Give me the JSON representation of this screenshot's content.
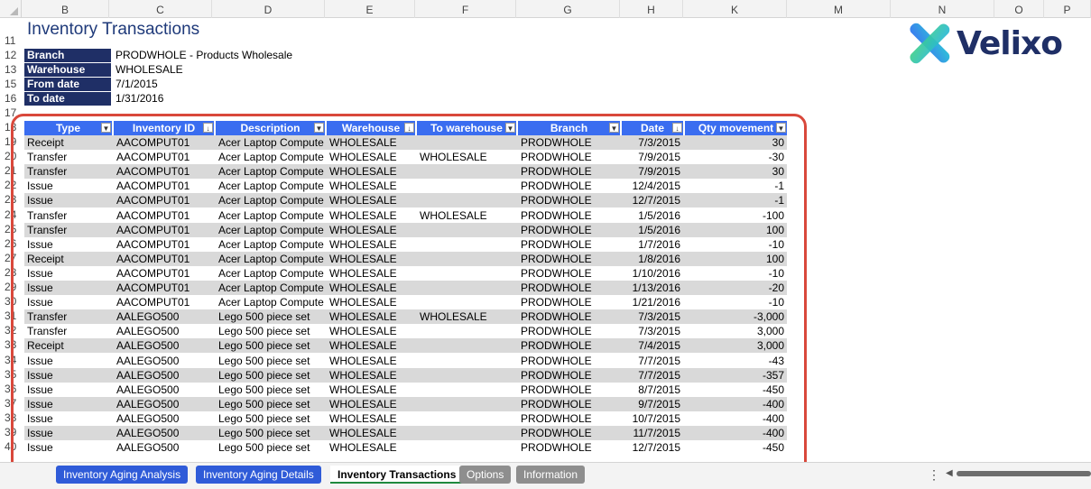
{
  "columns": [
    "B",
    "C",
    "D",
    "E",
    "F",
    "G",
    "H",
    "K",
    "M",
    "N",
    "O",
    "P"
  ],
  "row_numbers": [
    "11",
    "12",
    "13",
    "15",
    "16",
    "17",
    "18",
    "19",
    "20",
    "21",
    "22",
    "23",
    "24",
    "25",
    "26",
    "27",
    "28",
    "29",
    "30",
    "31",
    "32",
    "33",
    "34",
    "35",
    "36",
    "37",
    "38",
    "39",
    "40"
  ],
  "title": "Inventory Transactions",
  "params": [
    {
      "label": "Branch",
      "value": "PRODWHOLE - Products Wholesale"
    },
    {
      "label": "Warehouse",
      "value": "WHOLESALE"
    },
    {
      "label": "From date",
      "value": "7/1/2015"
    },
    {
      "label": "To date",
      "value": "1/31/2016"
    }
  ],
  "logo": {
    "text": "Velixo",
    "icon": "velixo-x-logo-icon"
  },
  "table": {
    "headers": [
      "Type",
      "Inventory ID",
      "Description",
      "Warehouse",
      "To warehouse",
      "Branch",
      "Date",
      "Qty movement"
    ],
    "rows": [
      [
        "Receipt",
        "AACOMPUT01",
        "Acer Laptop Compute",
        "WHOLESALE",
        "",
        "PRODWHOLE",
        "7/3/2015",
        "30"
      ],
      [
        "Transfer",
        "AACOMPUT01",
        "Acer Laptop Compute",
        "WHOLESALE",
        "WHOLESALE",
        "PRODWHOLE",
        "7/9/2015",
        "-30"
      ],
      [
        "Transfer",
        "AACOMPUT01",
        "Acer Laptop Compute",
        "WHOLESALE",
        "",
        "PRODWHOLE",
        "7/9/2015",
        "30"
      ],
      [
        "Issue",
        "AACOMPUT01",
        "Acer Laptop Compute",
        "WHOLESALE",
        "",
        "PRODWHOLE",
        "12/4/2015",
        "-1"
      ],
      [
        "Issue",
        "AACOMPUT01",
        "Acer Laptop Compute",
        "WHOLESALE",
        "",
        "PRODWHOLE",
        "12/7/2015",
        "-1"
      ],
      [
        "Transfer",
        "AACOMPUT01",
        "Acer Laptop Compute",
        "WHOLESALE",
        "WHOLESALE",
        "PRODWHOLE",
        "1/5/2016",
        "-100"
      ],
      [
        "Transfer",
        "AACOMPUT01",
        "Acer Laptop Compute",
        "WHOLESALE",
        "",
        "PRODWHOLE",
        "1/5/2016",
        "100"
      ],
      [
        "Issue",
        "AACOMPUT01",
        "Acer Laptop Compute",
        "WHOLESALE",
        "",
        "PRODWHOLE",
        "1/7/2016",
        "-10"
      ],
      [
        "Receipt",
        "AACOMPUT01",
        "Acer Laptop Compute",
        "WHOLESALE",
        "",
        "PRODWHOLE",
        "1/8/2016",
        "100"
      ],
      [
        "Issue",
        "AACOMPUT01",
        "Acer Laptop Compute",
        "WHOLESALE",
        "",
        "PRODWHOLE",
        "1/10/2016",
        "-10"
      ],
      [
        "Issue",
        "AACOMPUT01",
        "Acer Laptop Compute",
        "WHOLESALE",
        "",
        "PRODWHOLE",
        "1/13/2016",
        "-20"
      ],
      [
        "Issue",
        "AACOMPUT01",
        "Acer Laptop Compute",
        "WHOLESALE",
        "",
        "PRODWHOLE",
        "1/21/2016",
        "-10"
      ],
      [
        "Transfer",
        "AALEGO500",
        "Lego 500 piece set",
        "WHOLESALE",
        "WHOLESALE",
        "PRODWHOLE",
        "7/3/2015",
        "-3,000"
      ],
      [
        "Transfer",
        "AALEGO500",
        "Lego 500 piece set",
        "WHOLESALE",
        "",
        "PRODWHOLE",
        "7/3/2015",
        "3,000"
      ],
      [
        "Receipt",
        "AALEGO500",
        "Lego 500 piece set",
        "WHOLESALE",
        "",
        "PRODWHOLE",
        "7/4/2015",
        "3,000"
      ],
      [
        "Issue",
        "AALEGO500",
        "Lego 500 piece set",
        "WHOLESALE",
        "",
        "PRODWHOLE",
        "7/7/2015",
        "-43"
      ],
      [
        "Issue",
        "AALEGO500",
        "Lego 500 piece set",
        "WHOLESALE",
        "",
        "PRODWHOLE",
        "7/7/2015",
        "-357"
      ],
      [
        "Issue",
        "AALEGO500",
        "Lego 500 piece set",
        "WHOLESALE",
        "",
        "PRODWHOLE",
        "8/7/2015",
        "-450"
      ],
      [
        "Issue",
        "AALEGO500",
        "Lego 500 piece set",
        "WHOLESALE",
        "",
        "PRODWHOLE",
        "9/7/2015",
        "-400"
      ],
      [
        "Issue",
        "AALEGO500",
        "Lego 500 piece set",
        "WHOLESALE",
        "",
        "PRODWHOLE",
        "10/7/2015",
        "-400"
      ],
      [
        "Issue",
        "AALEGO500",
        "Lego 500 piece set",
        "WHOLESALE",
        "",
        "PRODWHOLE",
        "11/7/2015",
        "-400"
      ],
      [
        "Issue",
        "AALEGO500",
        "Lego 500 piece set",
        "WHOLESALE",
        "",
        "PRODWHOLE",
        "12/7/2015",
        "-450"
      ]
    ]
  },
  "sheet_tabs": [
    {
      "label": "Inventory Aging Analysis",
      "style": "blue"
    },
    {
      "label": "Inventory Aging Details",
      "style": "blue"
    },
    {
      "label": "Inventory Transactions",
      "style": "active"
    },
    {
      "label": "Options",
      "style": "grey"
    },
    {
      "label": "Information",
      "style": "grey"
    }
  ],
  "colors": {
    "header_blue": "#3a6df0",
    "label_navy": "#1f2f66",
    "highlight_red": "#d9483b"
  }
}
